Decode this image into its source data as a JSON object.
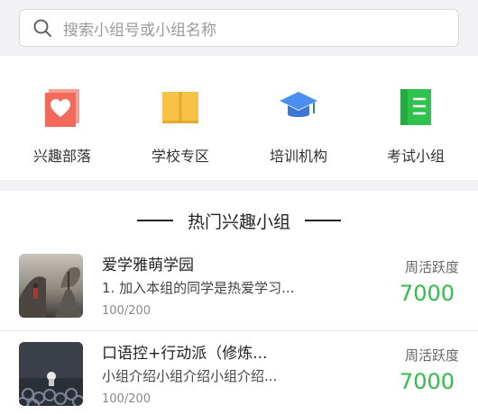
{
  "search": {
    "placeholder": "搜索小组号或小组名称"
  },
  "categories": [
    {
      "label": "兴趣部落",
      "icon": "heart-icon",
      "color": "#f36a5a"
    },
    {
      "label": "学校专区",
      "icon": "book-icon",
      "color": "#f8c246"
    },
    {
      "label": "培训机构",
      "icon": "graduation-cap-icon",
      "color": "#4a8ff0"
    },
    {
      "label": "考试小组",
      "icon": "notebook-icon",
      "color": "#2fc24f"
    }
  ],
  "hot": {
    "title": "热门兴趣小组",
    "groups": [
      {
        "name": "爱学雅萌学园",
        "desc": "1. 加入本组的同学是热爱学习...",
        "count": "100/200",
        "activity_label": "周活跃度",
        "activity_value": "7000"
      },
      {
        "name": "口语控+行动派（修炼...",
        "desc": "小组介绍小组介绍小组介绍...",
        "count": "100/200",
        "activity_label": "周活跃度",
        "activity_value": "7000"
      }
    ]
  }
}
